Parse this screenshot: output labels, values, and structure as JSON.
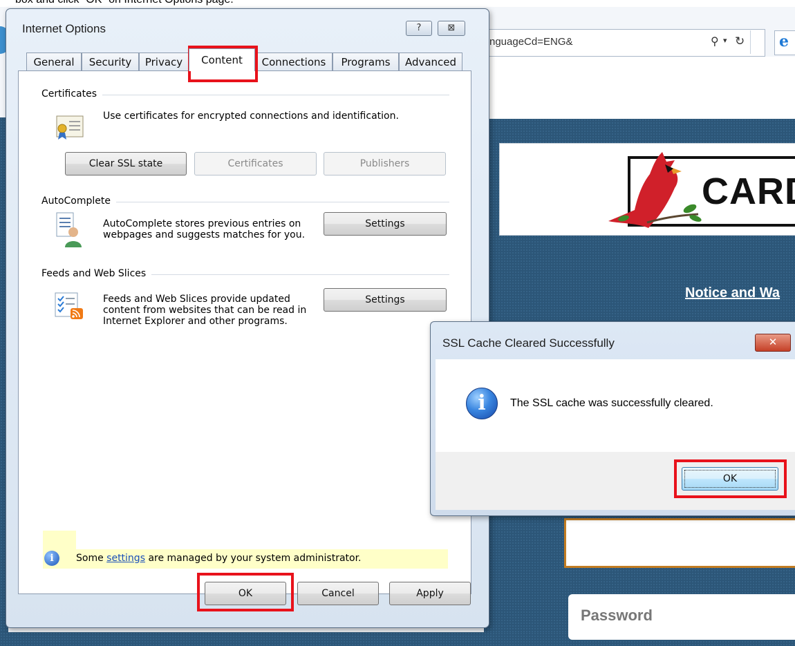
{
  "doc_instruction": "box and click “OK” on Internet Options page.",
  "browser": {
    "address_text": "nguageCd=ENG&",
    "search_icon": "search-icon",
    "refresh_icon": "refresh-icon",
    "logo_text": "CARD",
    "notice_link": "Notice and Wa",
    "password_placeholder": "Password"
  },
  "internet_options": {
    "title": "Internet Options",
    "help_glyph": "?",
    "close_glyph": "⊠",
    "tabs": [
      "General",
      "Security",
      "Privacy",
      "Content",
      "Connections",
      "Programs",
      "Advanced"
    ],
    "active_tab": "Content",
    "certificates": {
      "label": "Certificates",
      "description": "Use certificates for encrypted connections and identification.",
      "buttons": [
        "Clear SSL state",
        "Certificates",
        "Publishers"
      ]
    },
    "autocomplete": {
      "label": "AutoComplete",
      "description": "AutoComplete stores previous entries on webpages and suggests matches for you.",
      "settings_label": "Settings"
    },
    "feeds": {
      "label": "Feeds and Web Slices",
      "description": "Feeds and Web Slices provide updated content from websites that can be read in Internet Explorer and other programs.",
      "settings_label": "Settings"
    },
    "admin_notice": {
      "before": "Some ",
      "link": "settings",
      "after": " are managed by your system administrator."
    },
    "footer_buttons": {
      "ok": "OK",
      "cancel": "Cancel",
      "apply": "Apply"
    }
  },
  "ssl_dialog": {
    "title": "SSL Cache Cleared Successfully",
    "close_glyph": "✕",
    "message": "The SSL cache was successfully cleared.",
    "ok_label": "OK"
  },
  "colors": {
    "highlight": "#e8121b",
    "page_background": "#2c5678",
    "cardinal": "#d0202a"
  }
}
